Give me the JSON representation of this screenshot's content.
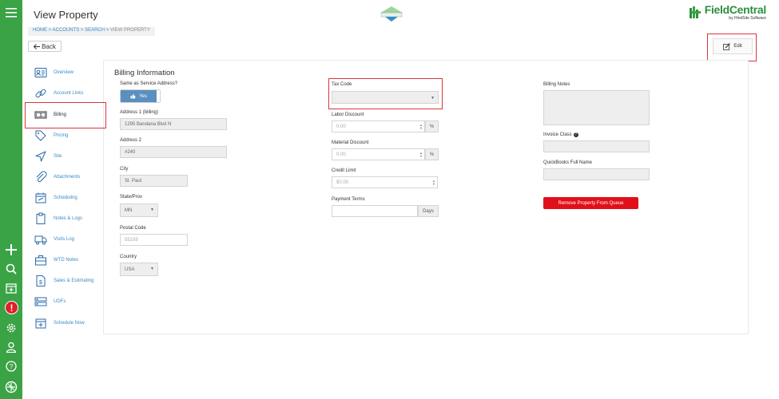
{
  "header": {
    "title": "View Property",
    "brand_name": "FieldCentral",
    "brand_sub": "by HindSite Software"
  },
  "breadcrumb": {
    "home": "HOME",
    "accounts": "ACCOUNTS",
    "search": "SEARCH",
    "current": "VIEW PROPERTY",
    "sep": ">"
  },
  "back_label": "Back",
  "edit_label": "Edit",
  "nav": {
    "items": [
      {
        "label": "Overview",
        "icon": "contact-card-icon"
      },
      {
        "label": "Account Links",
        "icon": "link-icon"
      },
      {
        "label": "Billing",
        "icon": "money-icon"
      },
      {
        "label": "Pricing",
        "icon": "tag-icon"
      },
      {
        "label": "Site",
        "icon": "location-arrow-icon"
      },
      {
        "label": "Attachments",
        "icon": "paperclip-icon"
      },
      {
        "label": "Scheduling",
        "icon": "calendar-icon"
      },
      {
        "label": "Notes & Logs",
        "icon": "clipboard-icon"
      },
      {
        "label": "Visits Log",
        "icon": "truck-icon"
      },
      {
        "label": "WTD Notes",
        "icon": "briefcase-icon"
      },
      {
        "label": "Sales & Estimating",
        "icon": "dollar-doc-icon"
      },
      {
        "label": "UDFs",
        "icon": "fields-icon"
      },
      {
        "label": "Schedule Now",
        "icon": "calendar-plus-icon"
      }
    ]
  },
  "billing": {
    "section_title": "Billing Information",
    "same_as_service_label": "Same as Service Address?",
    "same_as_service_value": "Yes",
    "address1_label": "Address 1 (billing)",
    "address1_value": "1295 Bandana Blvd N",
    "address2_label": "Address 2",
    "address2_value": "#240",
    "city_label": "City",
    "city_value": "St. Paul",
    "state_label": "State/Prov",
    "state_value": "MN",
    "postal_label": "Postal Code",
    "postal_placeholder": "55108",
    "country_label": "Country",
    "country_value": "USA",
    "tax_code_label": "Tax Code",
    "tax_code_value": "",
    "labor_discount_label": "Labor Discount",
    "labor_discount_value": "0.00",
    "material_discount_label": "Material Discount",
    "material_discount_value": "0.00",
    "percent": "%",
    "credit_limit_label": "Credit Limit",
    "credit_limit_value": "$0.00",
    "payment_terms_label": "Payment Terms",
    "payment_terms_value": "",
    "days": "Days",
    "billing_notes_label": "Billing Notes",
    "invoice_class_label": "Invoice Class",
    "qb_full_name_label": "QuickBooks Full Name",
    "remove_button": "Remove Property From Queue"
  },
  "colors": {
    "rail": "#3aa346",
    "link": "#3a8bc8",
    "highlight": "#d9363e",
    "remove": "#e0101a",
    "toggle_on": "#5b8fc0"
  }
}
